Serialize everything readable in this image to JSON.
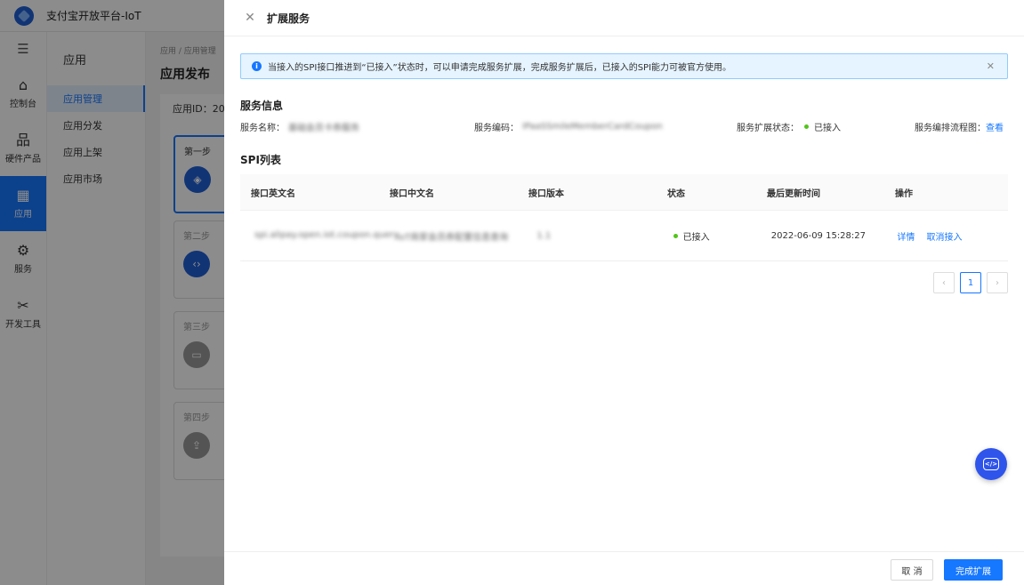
{
  "app": {
    "title": "支付宝开放平台-IoT"
  },
  "rail": {
    "items": [
      {
        "label": "控制台",
        "icon": "home-icon",
        "glyph": "⌂"
      },
      {
        "label": "硬件产品",
        "icon": "hardware-icon",
        "glyph": "品"
      },
      {
        "label": "应用",
        "icon": "apps-icon",
        "glyph": "▦"
      },
      {
        "label": "服务",
        "icon": "gear-icon",
        "glyph": "⚙"
      },
      {
        "label": "开发工具",
        "icon": "tools-icon",
        "glyph": "✂"
      }
    ]
  },
  "subnav": {
    "title": "应用",
    "items": [
      "应用管理",
      "应用分发",
      "应用上架",
      "应用市场"
    ]
  },
  "background": {
    "breadcrumb": "应用  /  应用管理",
    "page_title": "应用发布",
    "app_id_label": "应用ID：202",
    "steps": [
      "第一步",
      "第二步",
      "第三步",
      "第四步"
    ]
  },
  "drawer": {
    "title": "扩展服务",
    "alert": "当接入的SPI接口推进到“已接入”状态时，可以申请完成服务扩展，完成服务扩展后，已接入的SPI能力可被官方使用。",
    "service_info": {
      "section_title": "服务信息",
      "name_label": "服务名称：",
      "name_value": "基础会员卡券服务",
      "code_label": "服务编码：",
      "code_value": "IPaaSSmileMemberCardCoupon",
      "status_label": "服务扩展状态：",
      "status_value": "已接入",
      "flow_label": "服务编排流程图：",
      "flow_link": "查看"
    },
    "spi": {
      "section_title": "SPI列表",
      "columns": [
        "接口英文名",
        "接口中文名",
        "接口版本",
        "状态",
        "最后更新时间",
        "操作"
      ],
      "rows": [
        {
          "en_name": "spi.alipay.open.iot.coupon.query",
          "cn_name": "IoT商家会员券配置信息查询",
          "version": "1.1",
          "status": "已接入",
          "updated": "2022-06-09 15:28:27",
          "actions": [
            "详情",
            "取消接入"
          ]
        }
      ]
    },
    "pagination": {
      "prev": "‹",
      "current": "1",
      "next": "›"
    },
    "footer": {
      "cancel": "取 消",
      "confirm": "完成扩展"
    }
  },
  "colors": {
    "primary": "#1677ff",
    "success": "#52c41a",
    "fab": "#2f54eb"
  }
}
